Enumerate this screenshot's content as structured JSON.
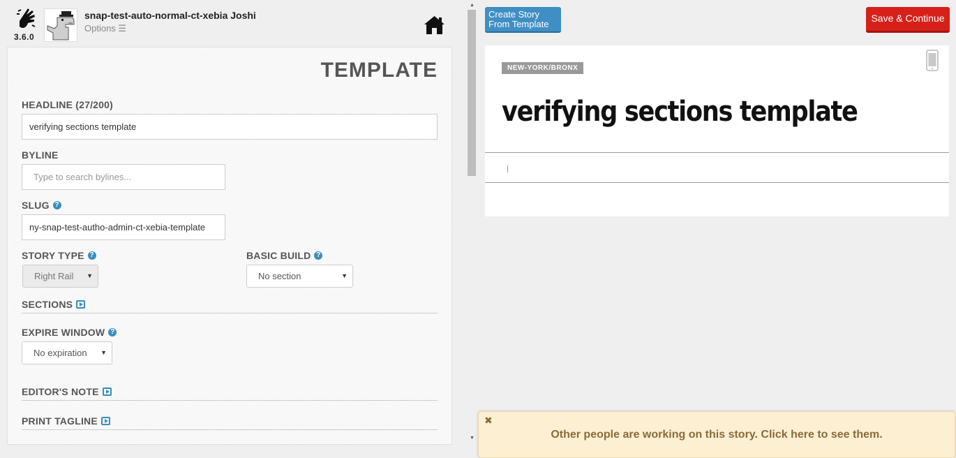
{
  "header": {
    "version": "3.6.0",
    "user_name": "snap-test-auto-normal-ct-xebia Joshi",
    "options_label": "Options ☰"
  },
  "form": {
    "title": "TEMPLATE",
    "headline_label": "HEADLINE (27/200)",
    "headline_value": "verifying sections template",
    "byline_label": "BYLINE",
    "byline_placeholder": "Type to search bylines...",
    "slug_label": "SLUG",
    "slug_value": "ny-snap-test-autho-admin-ct-xebia-template",
    "story_type_label": "STORY TYPE",
    "story_type_value": "Right Rail",
    "basic_build_label": "BASIC BUILD",
    "basic_build_value": "No section",
    "sections_label": "SECTIONS",
    "expire_window_label": "EXPIRE WINDOW",
    "expire_window_value": "No expiration",
    "editors_note_label": "EDITOR'S NOTE",
    "print_tagline_label": "PRINT TAGLINE"
  },
  "toolbar": {
    "create_template_label": "Create Story From Template",
    "save_continue_label": "Save & Continue"
  },
  "preview": {
    "section_tag": "NEW-YORK/BRONX",
    "headline": "verifying sections template"
  },
  "notification": {
    "close_label": "✖",
    "message": "Other people are working on this story. Click here to see them."
  },
  "colors": {
    "accent_blue": "#3f8fc4",
    "save_red": "#d7201a",
    "notify_bg": "#fdf0d2",
    "notify_text": "#8a6a3a"
  }
}
